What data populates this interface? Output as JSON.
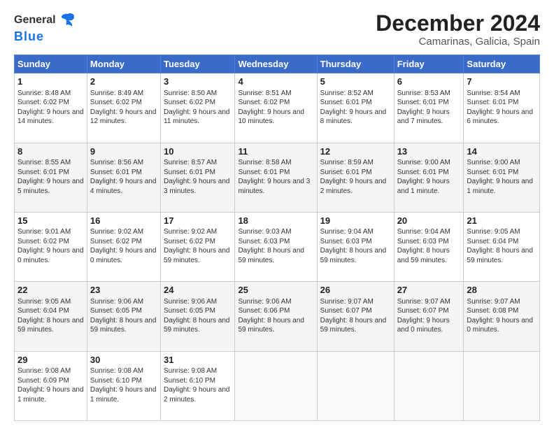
{
  "header": {
    "logo_general": "General",
    "logo_blue": "Blue",
    "title": "December 2024",
    "subtitle": "Camarinas, Galicia, Spain"
  },
  "days_of_week": [
    "Sunday",
    "Monday",
    "Tuesday",
    "Wednesday",
    "Thursday",
    "Friday",
    "Saturday"
  ],
  "weeks": [
    [
      {
        "day": "1",
        "sunrise": "Sunrise: 8:48 AM",
        "sunset": "Sunset: 6:02 PM",
        "daylight": "Daylight: 9 hours and 14 minutes."
      },
      {
        "day": "2",
        "sunrise": "Sunrise: 8:49 AM",
        "sunset": "Sunset: 6:02 PM",
        "daylight": "Daylight: 9 hours and 12 minutes."
      },
      {
        "day": "3",
        "sunrise": "Sunrise: 8:50 AM",
        "sunset": "Sunset: 6:02 PM",
        "daylight": "Daylight: 9 hours and 11 minutes."
      },
      {
        "day": "4",
        "sunrise": "Sunrise: 8:51 AM",
        "sunset": "Sunset: 6:02 PM",
        "daylight": "Daylight: 9 hours and 10 minutes."
      },
      {
        "day": "5",
        "sunrise": "Sunrise: 8:52 AM",
        "sunset": "Sunset: 6:01 PM",
        "daylight": "Daylight: 9 hours and 8 minutes."
      },
      {
        "day": "6",
        "sunrise": "Sunrise: 8:53 AM",
        "sunset": "Sunset: 6:01 PM",
        "daylight": "Daylight: 9 hours and 7 minutes."
      },
      {
        "day": "7",
        "sunrise": "Sunrise: 8:54 AM",
        "sunset": "Sunset: 6:01 PM",
        "daylight": "Daylight: 9 hours and 6 minutes."
      }
    ],
    [
      {
        "day": "8",
        "sunrise": "Sunrise: 8:55 AM",
        "sunset": "Sunset: 6:01 PM",
        "daylight": "Daylight: 9 hours and 5 minutes."
      },
      {
        "day": "9",
        "sunrise": "Sunrise: 8:56 AM",
        "sunset": "Sunset: 6:01 PM",
        "daylight": "Daylight: 9 hours and 4 minutes."
      },
      {
        "day": "10",
        "sunrise": "Sunrise: 8:57 AM",
        "sunset": "Sunset: 6:01 PM",
        "daylight": "Daylight: 9 hours and 3 minutes."
      },
      {
        "day": "11",
        "sunrise": "Sunrise: 8:58 AM",
        "sunset": "Sunset: 6:01 PM",
        "daylight": "Daylight: 9 hours and 3 minutes."
      },
      {
        "day": "12",
        "sunrise": "Sunrise: 8:59 AM",
        "sunset": "Sunset: 6:01 PM",
        "daylight": "Daylight: 9 hours and 2 minutes."
      },
      {
        "day": "13",
        "sunrise": "Sunrise: 9:00 AM",
        "sunset": "Sunset: 6:01 PM",
        "daylight": "Daylight: 9 hours and 1 minute."
      },
      {
        "day": "14",
        "sunrise": "Sunrise: 9:00 AM",
        "sunset": "Sunset: 6:01 PM",
        "daylight": "Daylight: 9 hours and 1 minute."
      }
    ],
    [
      {
        "day": "15",
        "sunrise": "Sunrise: 9:01 AM",
        "sunset": "Sunset: 6:02 PM",
        "daylight": "Daylight: 9 hours and 0 minutes."
      },
      {
        "day": "16",
        "sunrise": "Sunrise: 9:02 AM",
        "sunset": "Sunset: 6:02 PM",
        "daylight": "Daylight: 9 hours and 0 minutes."
      },
      {
        "day": "17",
        "sunrise": "Sunrise: 9:02 AM",
        "sunset": "Sunset: 6:02 PM",
        "daylight": "Daylight: 8 hours and 59 minutes."
      },
      {
        "day": "18",
        "sunrise": "Sunrise: 9:03 AM",
        "sunset": "Sunset: 6:03 PM",
        "daylight": "Daylight: 8 hours and 59 minutes."
      },
      {
        "day": "19",
        "sunrise": "Sunrise: 9:04 AM",
        "sunset": "Sunset: 6:03 PM",
        "daylight": "Daylight: 8 hours and 59 minutes."
      },
      {
        "day": "20",
        "sunrise": "Sunrise: 9:04 AM",
        "sunset": "Sunset: 6:03 PM",
        "daylight": "Daylight: 8 hours and 59 minutes."
      },
      {
        "day": "21",
        "sunrise": "Sunrise: 9:05 AM",
        "sunset": "Sunset: 6:04 PM",
        "daylight": "Daylight: 8 hours and 59 minutes."
      }
    ],
    [
      {
        "day": "22",
        "sunrise": "Sunrise: 9:05 AM",
        "sunset": "Sunset: 6:04 PM",
        "daylight": "Daylight: 8 hours and 59 minutes."
      },
      {
        "day": "23",
        "sunrise": "Sunrise: 9:06 AM",
        "sunset": "Sunset: 6:05 PM",
        "daylight": "Daylight: 8 hours and 59 minutes."
      },
      {
        "day": "24",
        "sunrise": "Sunrise: 9:06 AM",
        "sunset": "Sunset: 6:05 PM",
        "daylight": "Daylight: 8 hours and 59 minutes."
      },
      {
        "day": "25",
        "sunrise": "Sunrise: 9:06 AM",
        "sunset": "Sunset: 6:06 PM",
        "daylight": "Daylight: 8 hours and 59 minutes."
      },
      {
        "day": "26",
        "sunrise": "Sunrise: 9:07 AM",
        "sunset": "Sunset: 6:07 PM",
        "daylight": "Daylight: 8 hours and 59 minutes."
      },
      {
        "day": "27",
        "sunrise": "Sunrise: 9:07 AM",
        "sunset": "Sunset: 6:07 PM",
        "daylight": "Daylight: 9 hours and 0 minutes."
      },
      {
        "day": "28",
        "sunrise": "Sunrise: 9:07 AM",
        "sunset": "Sunset: 6:08 PM",
        "daylight": "Daylight: 9 hours and 0 minutes."
      }
    ],
    [
      {
        "day": "29",
        "sunrise": "Sunrise: 9:08 AM",
        "sunset": "Sunset: 6:09 PM",
        "daylight": "Daylight: 9 hours and 1 minute."
      },
      {
        "day": "30",
        "sunrise": "Sunrise: 9:08 AM",
        "sunset": "Sunset: 6:10 PM",
        "daylight": "Daylight: 9 hours and 1 minute."
      },
      {
        "day": "31",
        "sunrise": "Sunrise: 9:08 AM",
        "sunset": "Sunset: 6:10 PM",
        "daylight": "Daylight: 9 hours and 2 minutes."
      },
      null,
      null,
      null,
      null
    ]
  ]
}
